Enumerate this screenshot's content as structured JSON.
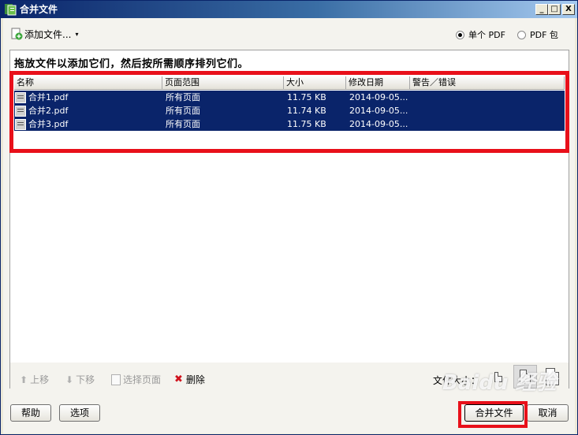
{
  "window": {
    "title": "合并文件",
    "min_label": "_",
    "max_label": "□",
    "close_label": "X"
  },
  "toolbar": {
    "add_files_label": "添加文件...",
    "dropdown_glyph": "▾",
    "options": [
      {
        "label": "单个 PDF",
        "checked": true
      },
      {
        "label": "PDF 包",
        "checked": false
      }
    ]
  },
  "panel": {
    "instruction": "拖放文件以添加它们，然后按所需顺序排列它们。"
  },
  "table": {
    "columns": [
      "名称",
      "页面范围",
      "大小",
      "修改日期",
      "警告／错误"
    ],
    "rows": [
      {
        "name": "合并1.pdf",
        "range": "所有页面",
        "size": "11.75 KB",
        "date": "2014-09-05...",
        "warning": ""
      },
      {
        "name": "合并2.pdf",
        "range": "所有页面",
        "size": "11.74 KB",
        "date": "2014-09-05...",
        "warning": ""
      },
      {
        "name": "合并3.pdf",
        "range": "所有页面",
        "size": "11.75 KB",
        "date": "2014-09-05...",
        "warning": ""
      }
    ]
  },
  "bottom_toolbar": {
    "move_up": "上移",
    "move_down": "下移",
    "select_pages": "选择页面",
    "delete": "删除",
    "file_size_label": "文件大小："
  },
  "buttons": {
    "help": "帮助",
    "options": "选项",
    "combine": "合并文件",
    "cancel": "取消"
  },
  "watermark": "Baidu 经验",
  "colors": {
    "selection": "#0a246a",
    "highlight": "#e8101a"
  }
}
